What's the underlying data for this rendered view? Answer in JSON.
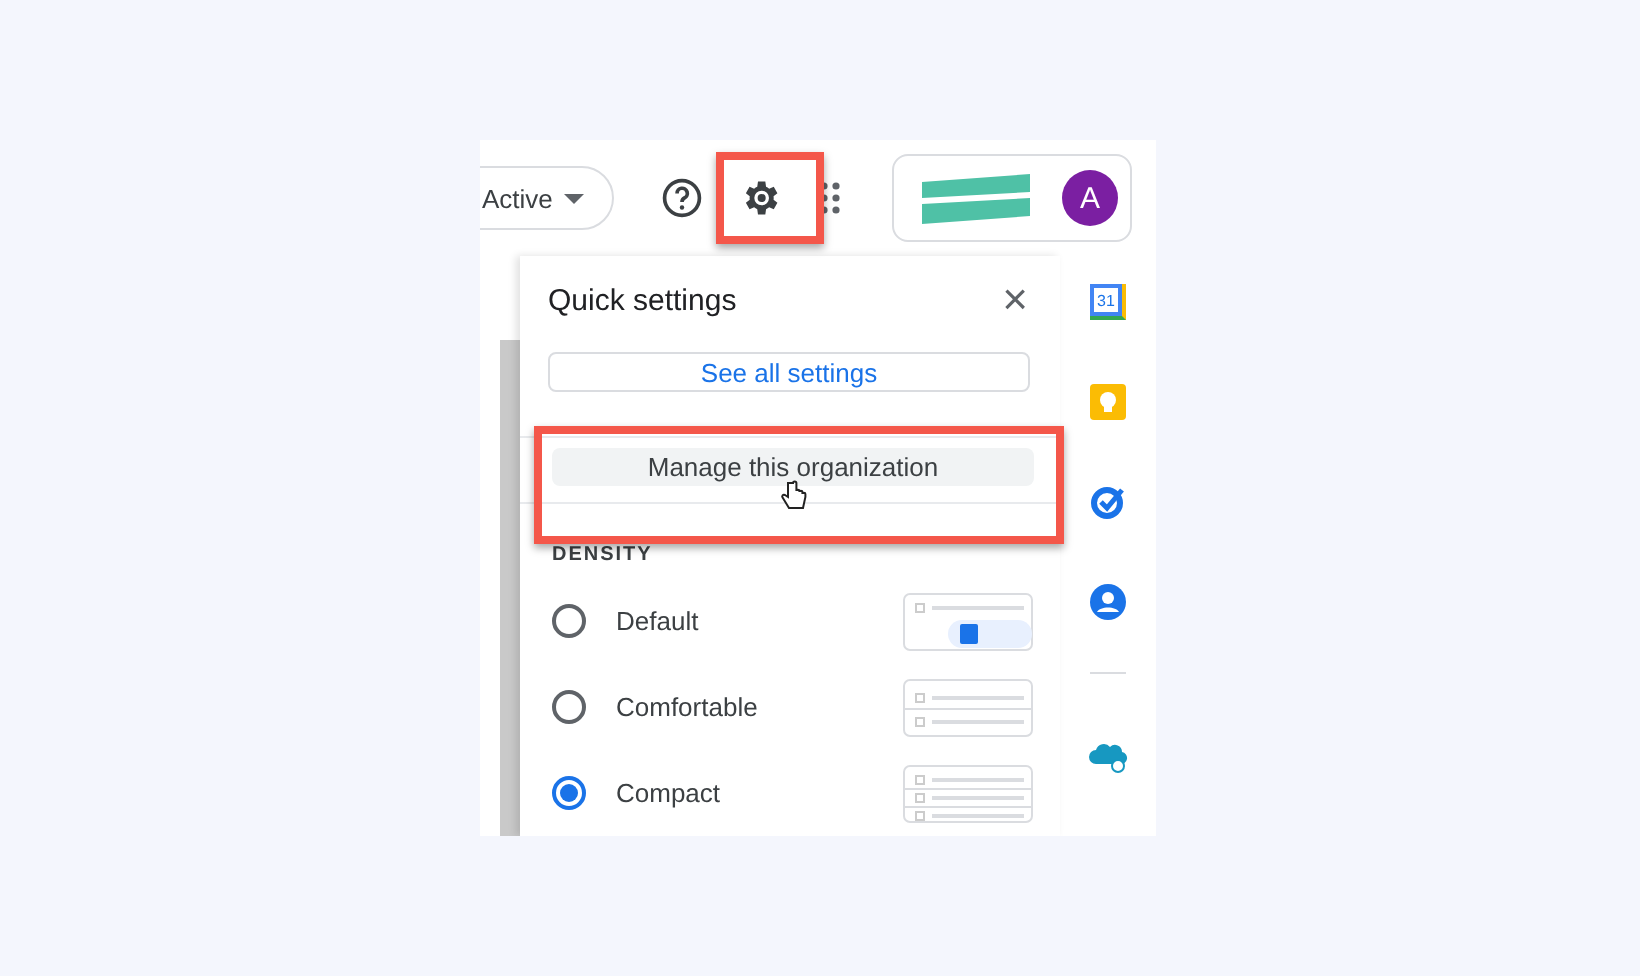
{
  "toolbar": {
    "status": {
      "label": "Active"
    },
    "settings": {
      "highlighted": true
    },
    "account": {
      "avatar": "A"
    }
  },
  "quick_settings": {
    "title": "Quick settings",
    "close": "×",
    "see_all": "See all settings",
    "manage": {
      "label": "Manage this organization",
      "highlighted": true
    },
    "density": {
      "heading": "DENSITY",
      "options": [
        {
          "label": "Default",
          "kind": "default",
          "selected": false
        },
        {
          "label": "Comfortable",
          "kind": "comfortable",
          "selected": false
        },
        {
          "label": "Compact",
          "kind": "compact",
          "selected": true
        }
      ]
    }
  },
  "side_apps": {
    "calendar_day": "31"
  }
}
